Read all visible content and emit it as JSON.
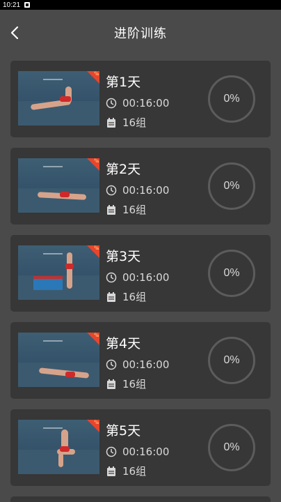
{
  "status_bar": {
    "time": "10:21"
  },
  "header": {
    "title": "进阶训练",
    "back_icon": "chevron-left-icon"
  },
  "cards": [
    {
      "day": "第1天",
      "duration": "00:16:00",
      "groups": "16组",
      "progress": "0%",
      "badge": "VIP"
    },
    {
      "day": "第2天",
      "duration": "00:16:00",
      "groups": "16组",
      "progress": "0%",
      "badge": "VIP"
    },
    {
      "day": "第3天",
      "duration": "00:16:00",
      "groups": "16组",
      "progress": "0%",
      "badge": "VIP"
    },
    {
      "day": "第4天",
      "duration": "00:16:00",
      "groups": "16组",
      "progress": "0%",
      "badge": "VIP"
    },
    {
      "day": "第5天",
      "duration": "00:16:00",
      "groups": "16组",
      "progress": "0%",
      "badge": "VIP"
    }
  ],
  "colors": {
    "background": "#4a4a4a",
    "card": "#373737",
    "ring": "#5c5c5c",
    "badge": "#e8452c"
  }
}
